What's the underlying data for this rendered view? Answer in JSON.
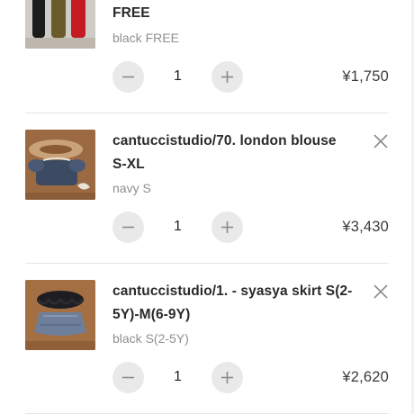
{
  "cart": {
    "items": [
      {
        "title_line2": "FREE",
        "variant": "black FREE",
        "quantity": "1",
        "price": "¥1,750",
        "thumb_icon": "tights-product-photo"
      },
      {
        "title": "cantuccistudio/70. london blouse S-XL",
        "variant": "navy S",
        "quantity": "1",
        "price": "¥3,430",
        "thumb_icon": "blouse-product-photo"
      },
      {
        "title": "cantuccistudio/1. - syasya skirt S(2-5Y)-M(6-9Y)",
        "variant": "black S(2-5Y)",
        "quantity": "1",
        "price": "¥2,620",
        "thumb_icon": "skirt-product-photo"
      }
    ]
  },
  "icons": {
    "minus": "minus-icon",
    "plus": "plus-icon",
    "remove": "close-icon"
  },
  "colors": {
    "stepper_bg": "#e9e9e9",
    "divider": "#e6e6e6",
    "variant_text": "#8f8f8f"
  }
}
